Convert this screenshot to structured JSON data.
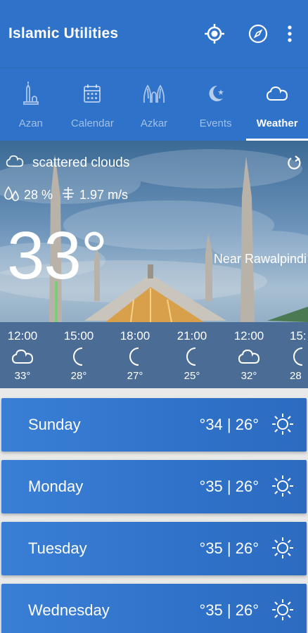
{
  "app": {
    "title": "Islamic Utilities"
  },
  "toolbar": {
    "actions": [
      "gps-icon",
      "compass-icon",
      "more-vert-icon"
    ]
  },
  "tabs": [
    {
      "label": "Azan",
      "icon": "minaret-icon",
      "active": false
    },
    {
      "label": "Calendar",
      "icon": "calendar-icon",
      "active": false
    },
    {
      "label": "Azkar",
      "icon": "praying-hands-icon",
      "active": false
    },
    {
      "label": "Events",
      "icon": "crescent-star-icon",
      "active": false
    },
    {
      "label": "Weather",
      "icon": "cloud-icon",
      "active": true
    }
  ],
  "current": {
    "condition": "scattered clouds",
    "humidity": "28 %",
    "wind": "1.97 m/s",
    "temperature": "33°",
    "location": "Near Rawalpindi"
  },
  "hourly": [
    {
      "time": "12:00",
      "icon": "cloud-icon",
      "temp": "33°"
    },
    {
      "time": "15:00",
      "icon": "moon-icon",
      "temp": "28°"
    },
    {
      "time": "18:00",
      "icon": "moon-icon",
      "temp": "27°"
    },
    {
      "time": "21:00",
      "icon": "moon-icon",
      "temp": "25°"
    },
    {
      "time": "12:00",
      "icon": "cloud-icon",
      "temp": "32°"
    },
    {
      "time": "15:",
      "icon": "moon-icon",
      "temp": "28"
    }
  ],
  "daily": [
    {
      "day": "Sunday",
      "range": "°34 | 26°",
      "icon": "sun-icon"
    },
    {
      "day": "Monday",
      "range": "°35 | 26°",
      "icon": "sun-icon"
    },
    {
      "day": "Tuesday",
      "range": "°35 | 26°",
      "icon": "sun-icon"
    },
    {
      "day": "Wednesday",
      "range": "°35 | 26°",
      "icon": "sun-icon"
    }
  ],
  "colors": {
    "primary": "#2f72c9",
    "text_on_primary": "#ffffff"
  }
}
